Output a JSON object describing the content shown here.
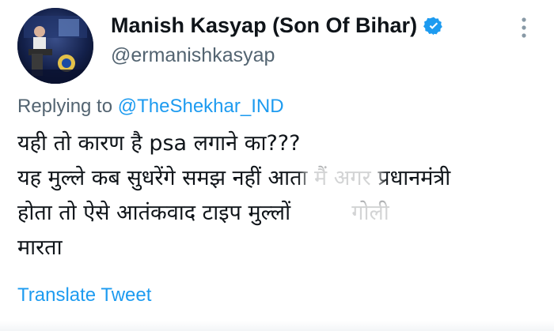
{
  "author": {
    "display_name": "Manish Kasyap (Son Of Bihar)",
    "handle": "@ermanishkasyap",
    "verified": true,
    "avatar_icon": "profile-photo"
  },
  "reply": {
    "prefix": "Replying to",
    "mention": "@TheShekhar_IND"
  },
  "tweet": {
    "lines": [
      "यही तो कारण है psa लगाने का???",
      "यह मुल्ले कब सुधरेंगे समझ नहीं आता मैं अगर प्रधानमंत्री",
      "होता तो ऐसे आतंकवाद टाइप मुल्लों         गोली",
      "मारता"
    ]
  },
  "actions": {
    "translate_label": "Translate Tweet",
    "more_icon": "more-vertical-icon"
  },
  "colors": {
    "accent": "#1d9bf0",
    "text": "#0f1419",
    "secondary": "#536471"
  }
}
